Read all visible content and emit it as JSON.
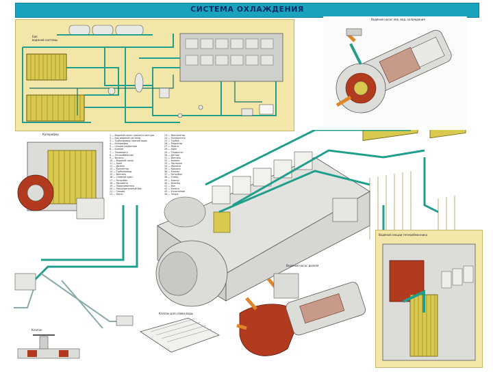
{
  "header": {
    "title": "СИСТЕМА ОХЛАЖДЕНИЯ"
  },
  "labels": {
    "schematic_reservoir": "Бак\nводяной системы",
    "radiator_side": "Калорифер",
    "water_pump": "Водяной насос",
    "valve_label": "Клапан",
    "cross_section": "Водяной насос дизеля",
    "filter_label": "Клапан для слива воды",
    "upper_right_label": "Водяной насос лев. вод. охлаждения",
    "inset_label": "Водяной секции теплообменника"
  },
  "legend": {
    "left": [
      "1 — Водяной насос горячего контура",
      "2 — Бак водяной системы",
      "3 — Трубопровод горячей воды",
      "4 — Калорифер",
      "5 — Секции радиатора",
      "6 — Клапан",
      "7 — Термометр",
      "8 — Теплообменник",
      "9 — Фильтр",
      "10 — Водяной насос",
      "11 — Кран",
      "12 — Дизель",
      "13 — Коллектор",
      "14 — Трубопровод",
      "15 — Вентиль",
      "16 — Сливной кран",
      "17 — Патрубок",
      "18 — Манометр",
      "19 — Подогреватель",
      "20 — Расширительный бак",
      "21 — Секция",
      "22 — Насос"
    ],
    "right": [
      "23 — Вентилятор",
      "24 — Охладитель",
      "25 — Трубка",
      "26 — Радиатор",
      "27 — Муфта",
      "28 — Кран",
      "29 — Термостат",
      "30 — Датчик",
      "31 — Вентиль",
      "32 — Колено",
      "33 — Заслонка",
      "34 — Жалюзи",
      "35 — Крышка",
      "36 — Клапан",
      "37 — Патрубок",
      "38 — Отвод",
      "39 — Корпус",
      "40 — Фланец",
      "41 — Вал",
      "42 — Колесо",
      "43 — Уплотнение",
      "44 — Опора"
    ]
  },
  "colors": {
    "pipe": "#1f9e8c",
    "pipe_dark": "#0e6f63",
    "radiator": "#d9c94f",
    "metal": "#dcdcd8",
    "rust": "#b23a1e",
    "background_panel": "#f2e6a8"
  }
}
